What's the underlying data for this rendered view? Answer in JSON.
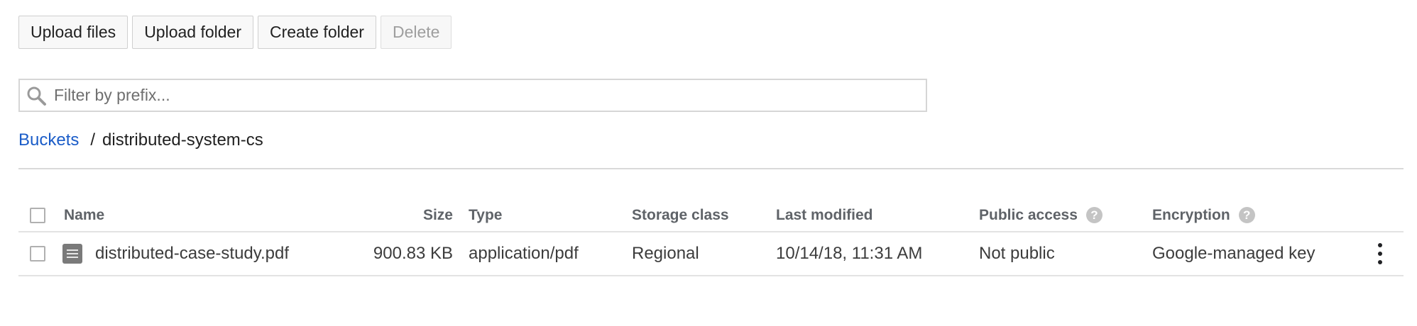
{
  "toolbar": {
    "upload_files": "Upload files",
    "upload_folder": "Upload folder",
    "create_folder": "Create folder",
    "delete": "Delete"
  },
  "filter": {
    "placeholder": "Filter by prefix...",
    "value": ""
  },
  "breadcrumb": {
    "root": "Buckets",
    "separator": "/",
    "current": "distributed-system-cs"
  },
  "table": {
    "columns": {
      "name": "Name",
      "size": "Size",
      "type": "Type",
      "storage_class": "Storage class",
      "last_modified": "Last modified",
      "public_access": "Public access",
      "encryption": "Encryption"
    },
    "help_glyph": "?",
    "rows": [
      {
        "name": "distributed-case-study.pdf",
        "size": "900.83 KB",
        "type": "application/pdf",
        "storage_class": "Regional",
        "last_modified": "10/14/18, 11:31 AM",
        "public_access": "Not public",
        "encryption": "Google-managed key",
        "icon": "file-document-icon"
      }
    ]
  },
  "colors": {
    "link": "#1a5cc8",
    "header_text": "#5f6368",
    "body_text": "#3c3c3c",
    "disabled_text": "#9e9e9e"
  }
}
